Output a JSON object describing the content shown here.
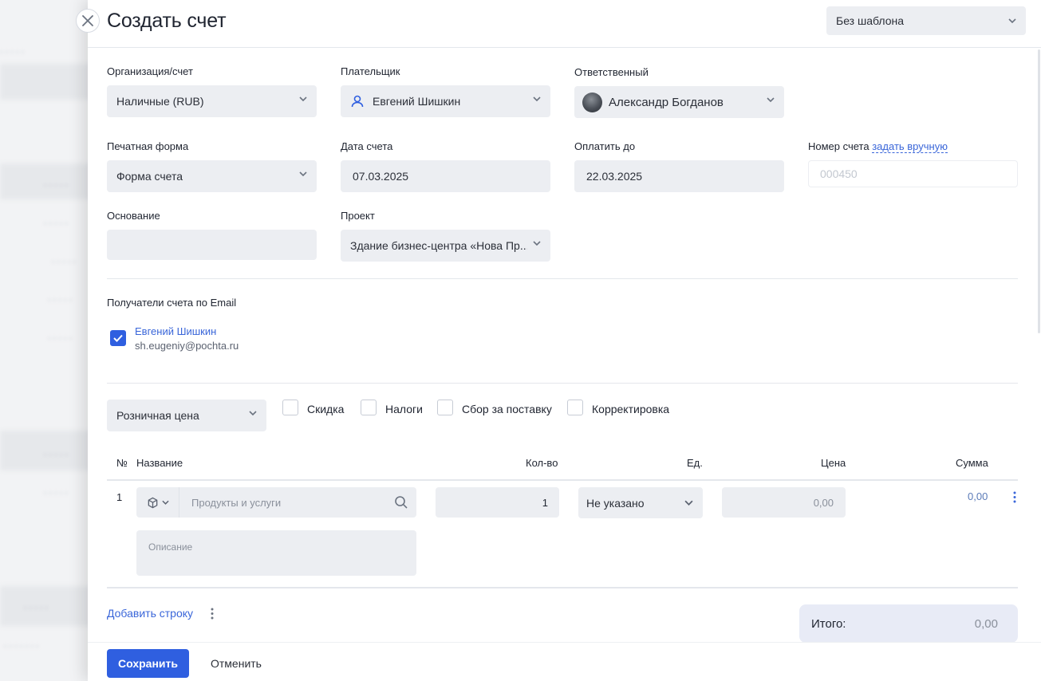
{
  "header": {
    "title": "Создать счет",
    "template_select": "Без шаблона"
  },
  "form": {
    "org": {
      "label": "Организация/счет",
      "value": "Наличные (RUB)"
    },
    "payer": {
      "label": "Плательщик",
      "value": "Евгений Шишкин"
    },
    "responsible": {
      "label": "Ответственный",
      "value": "Александр Богданов"
    },
    "print_form": {
      "label": "Печатная форма",
      "value": "Форма счета"
    },
    "invoice_date": {
      "label": "Дата счета",
      "value": "07.03.2025"
    },
    "pay_until": {
      "label": "Оплатить до",
      "value": "22.03.2025"
    },
    "invoice_number": {
      "label": "Номер счета",
      "link": "задать вручную",
      "placeholder": "000450"
    },
    "basis": {
      "label": "Основание",
      "value": ""
    },
    "project": {
      "label": "Проект",
      "value": "Здание бизнес-центра «Нова Пр..."
    }
  },
  "recipients": {
    "label": "Получатели счета по Email",
    "items": [
      {
        "name": "Евгений Шишкин",
        "email": "sh.eugeniy@pochta.ru",
        "checked": true
      }
    ]
  },
  "pricing": {
    "price_type": "Розничная цена",
    "options": [
      {
        "label": "Скидка",
        "checked": false
      },
      {
        "label": "Налоги",
        "checked": false
      },
      {
        "label": "Сбор за поставку",
        "checked": false
      },
      {
        "label": "Корректировка",
        "checked": false
      }
    ]
  },
  "table": {
    "headers": {
      "num": "№",
      "name": "Название",
      "qty": "Кол-во",
      "unit": "Ед.",
      "price": "Цена",
      "sum": "Сумма"
    },
    "rows": [
      {
        "num": "1",
        "product_placeholder": "Продукты и услуги",
        "qty": "1",
        "unit": "Не указано",
        "price": "0,00",
        "sum": "0,00",
        "description_placeholder": "Описание"
      }
    ]
  },
  "add_row": "Добавить строку",
  "total": {
    "label": "Итого:",
    "value": "0,00"
  },
  "footer": {
    "save": "Сохранить",
    "cancel": "Отменить"
  },
  "colors": {
    "accent": "#2f5fe0",
    "field_bg": "#eceef2",
    "link": "#3a66d9"
  }
}
